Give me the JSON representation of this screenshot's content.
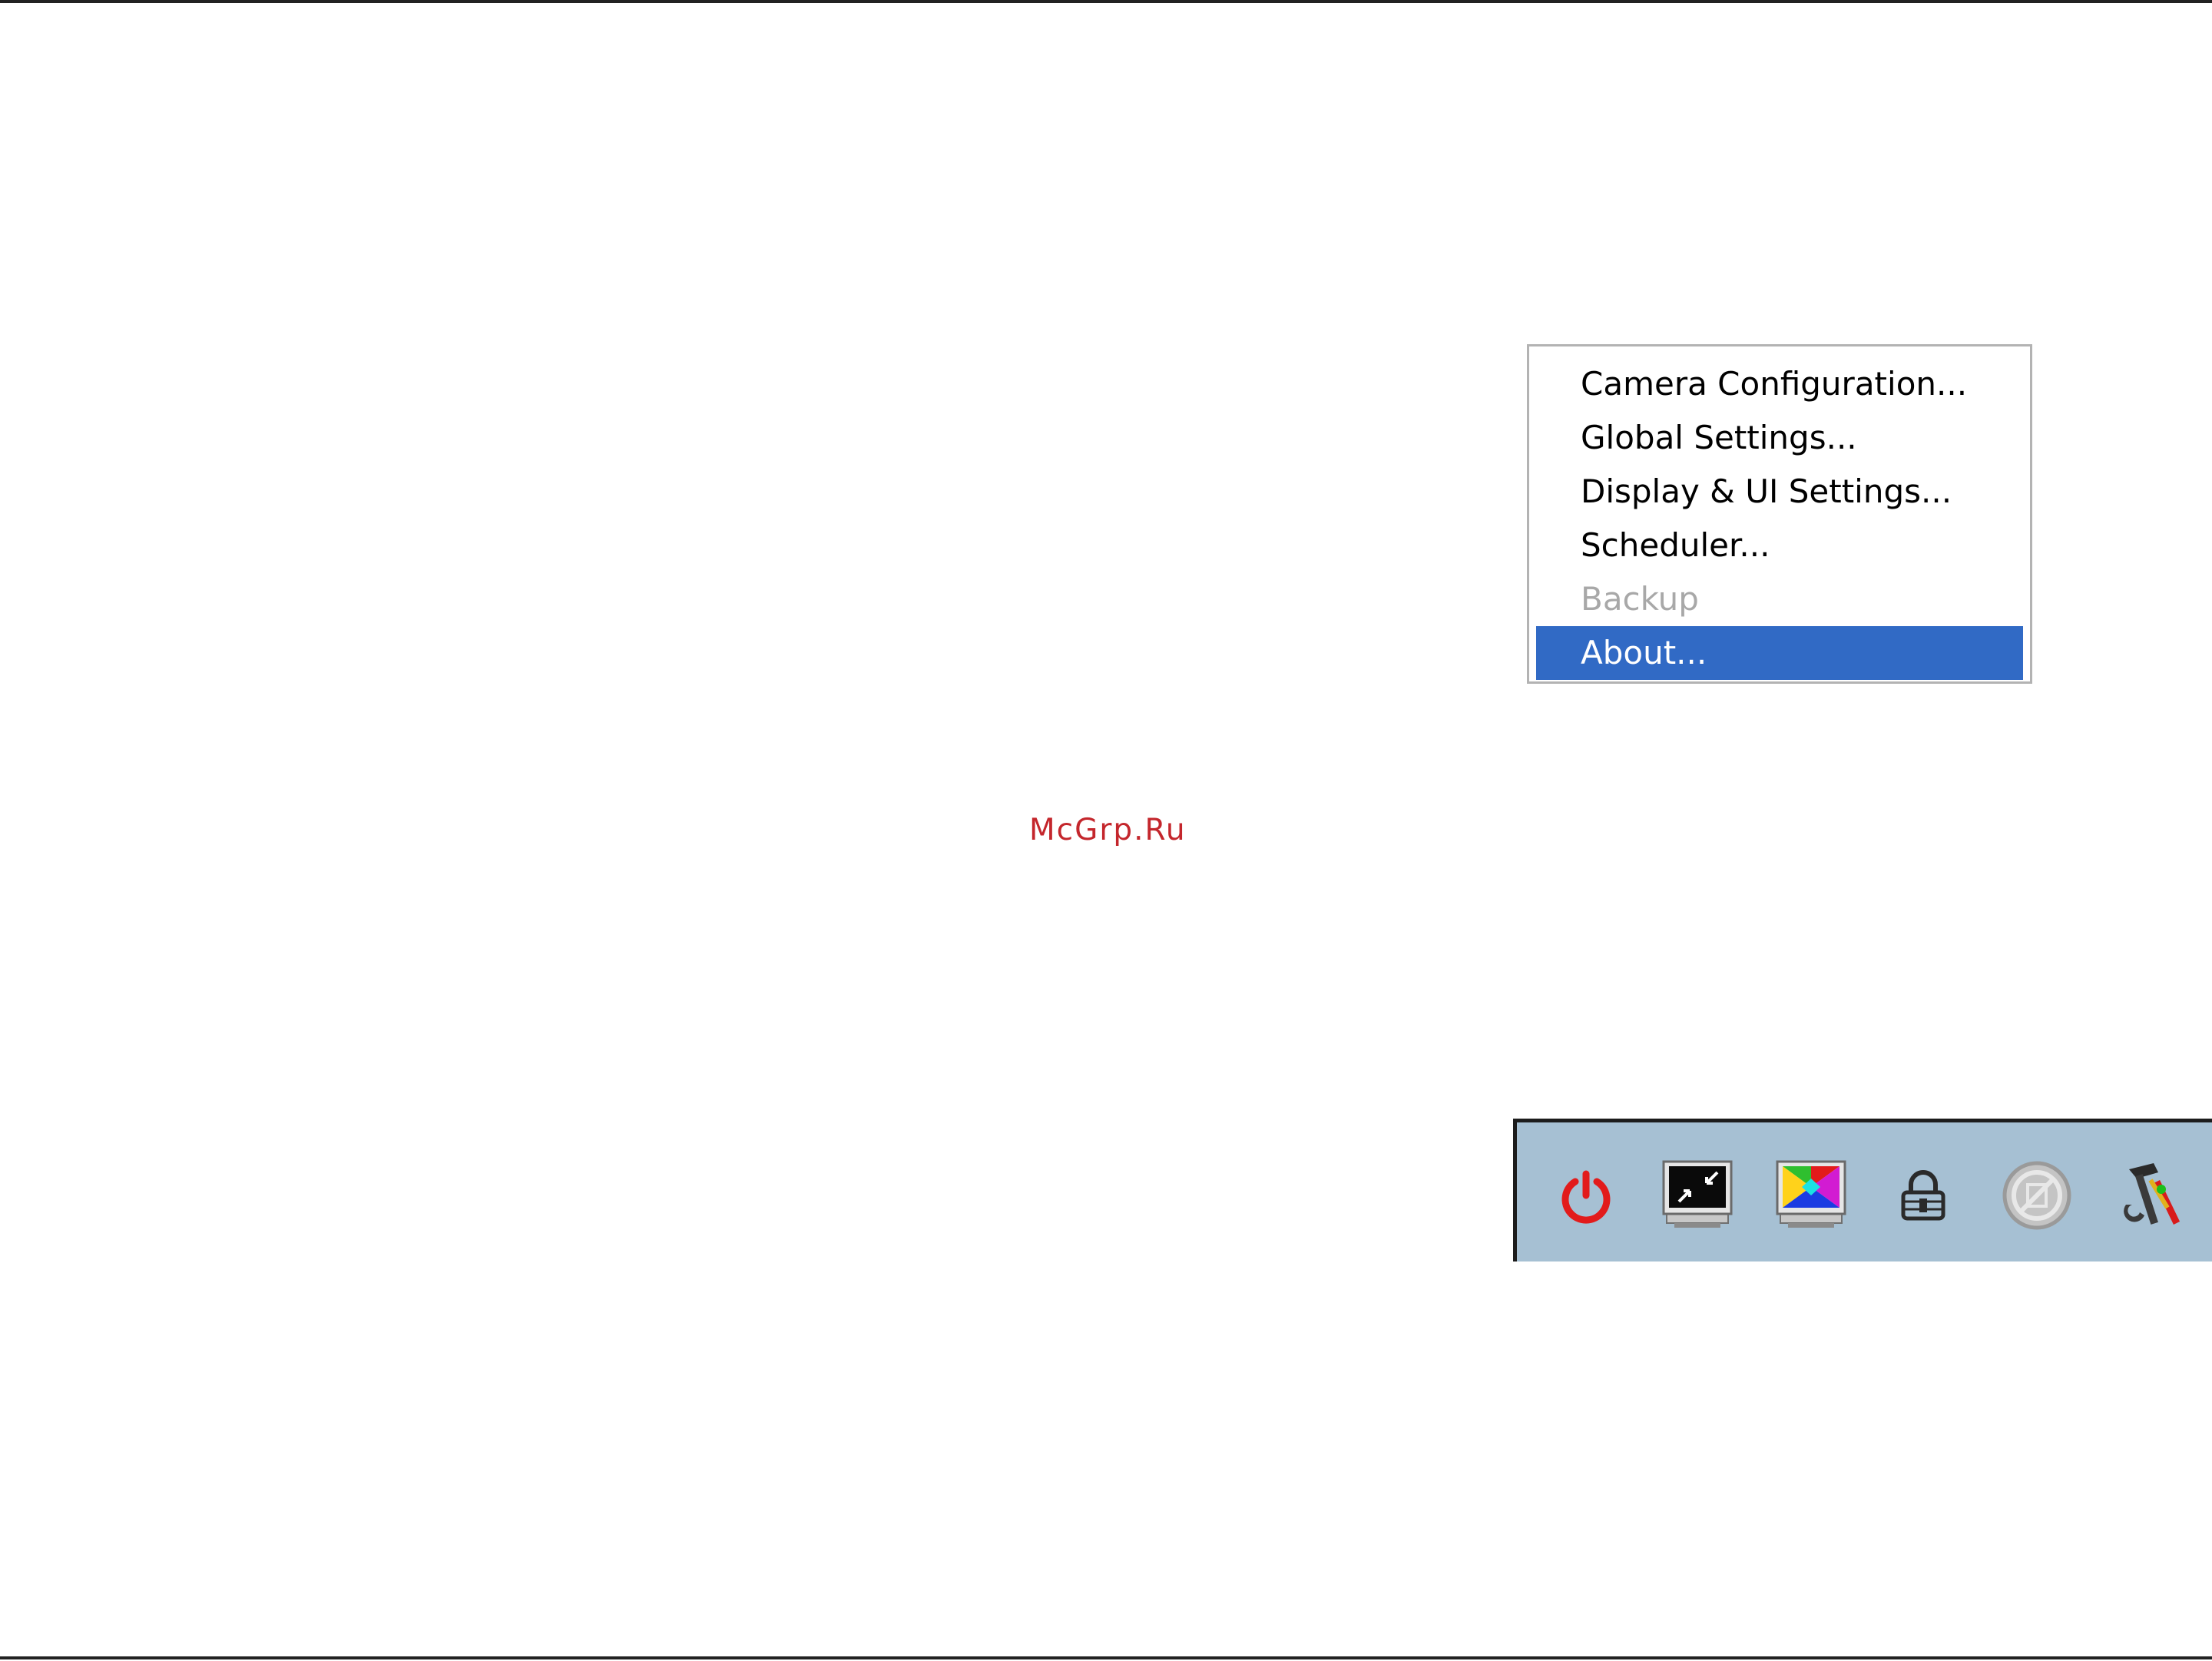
{
  "context_menu": {
    "items": [
      {
        "label": "Camera Configuration...",
        "state": "enabled"
      },
      {
        "label": "Global Settings...",
        "state": "enabled"
      },
      {
        "label": "Display & UI Settings...",
        "state": "enabled"
      },
      {
        "label": "Scheduler...",
        "state": "enabled"
      },
      {
        "label": "Backup",
        "state": "disabled"
      },
      {
        "label": "About...",
        "state": "selected"
      }
    ],
    "selection_color": "#316ac5"
  },
  "watermark": {
    "text": "McGrp.Ru",
    "color": "#c4262c"
  },
  "toolbar": {
    "background": "#a6c0d3",
    "buttons": [
      {
        "icon": "power-icon"
      },
      {
        "icon": "minimize-window-icon"
      },
      {
        "icon": "color-display-icon"
      },
      {
        "icon": "lock-icon"
      },
      {
        "icon": "disabled-circle-icon"
      },
      {
        "icon": "tools-icon"
      }
    ]
  }
}
